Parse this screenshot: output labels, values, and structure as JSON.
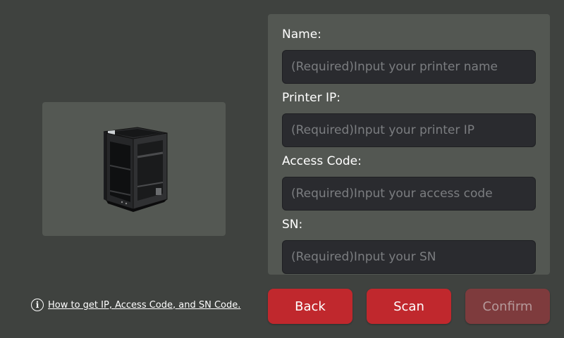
{
  "colors": {
    "background": "#3f423f",
    "panel": "#535752",
    "input_bg": "#2a2b2f",
    "accent": "#c0282d",
    "accent_disabled": "#7e3b3d"
  },
  "printer_image": {
    "icon": "3d-printer-image"
  },
  "form": {
    "name": {
      "label": "Name:",
      "value": "",
      "placeholder": "(Required)Input your printer name"
    },
    "printer_ip": {
      "label": "Printer IP:",
      "value": "",
      "placeholder": "(Required)Input your printer IP"
    },
    "access_code": {
      "label": "Access Code:",
      "value": "",
      "placeholder": "(Required)Input your access code"
    },
    "sn": {
      "label": "SN:",
      "value": "",
      "placeholder": "(Required)Input your SN"
    }
  },
  "help": {
    "icon": "info-icon",
    "text": "How to get IP, Access Code, and SN Code."
  },
  "buttons": {
    "back": "Back",
    "scan": "Scan",
    "confirm": "Confirm",
    "confirm_enabled": false
  }
}
